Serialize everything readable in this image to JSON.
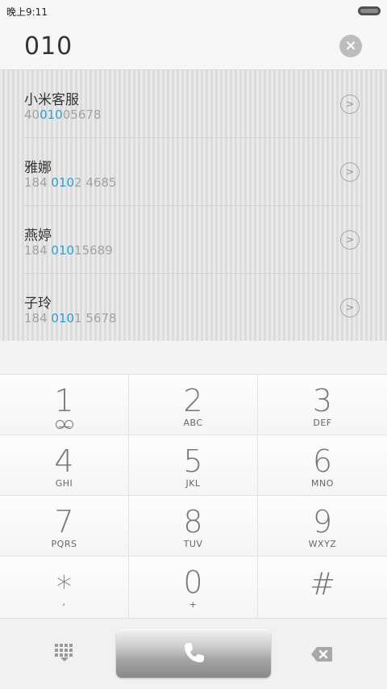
{
  "status_bar": {
    "time": "晚上9:11"
  },
  "dialer": {
    "input_value": "010",
    "clear_icon": "clear-circle-icon"
  },
  "results": [
    {
      "name": "小米客服",
      "number_parts": [
        "40",
        "010",
        "05678"
      ]
    },
    {
      "name": "雅娜",
      "number_parts": [
        "184 ",
        "010",
        "2 4685"
      ]
    },
    {
      "name": "燕婷",
      "number_parts": [
        "184 ",
        "010",
        "15689"
      ]
    },
    {
      "name": "子玲",
      "number_parts": [
        "184 ",
        "010",
        "1 5678"
      ]
    }
  ],
  "keypad": {
    "keys": [
      {
        "digit": "1",
        "sub": ""
      },
      {
        "digit": "2",
        "sub": "ABC"
      },
      {
        "digit": "3",
        "sub": "DEF"
      },
      {
        "digit": "4",
        "sub": "GHI"
      },
      {
        "digit": "5",
        "sub": "JKL"
      },
      {
        "digit": "6",
        "sub": "MNO"
      },
      {
        "digit": "7",
        "sub": "PQRS"
      },
      {
        "digit": "8",
        "sub": "TUV"
      },
      {
        "digit": "9",
        "sub": "WXYZ"
      },
      {
        "digit": "*",
        "sub": ","
      },
      {
        "digit": "0",
        "sub": "+"
      },
      {
        "digit": "#",
        "sub": ""
      }
    ]
  },
  "bottom_bar": {
    "keypad_icon": "dialpad-icon",
    "call_icon": "phone-icon",
    "backspace_icon": "backspace-icon"
  },
  "colors": {
    "highlight": "#2d9fd8",
    "number_gray": "#a3a3a3"
  }
}
